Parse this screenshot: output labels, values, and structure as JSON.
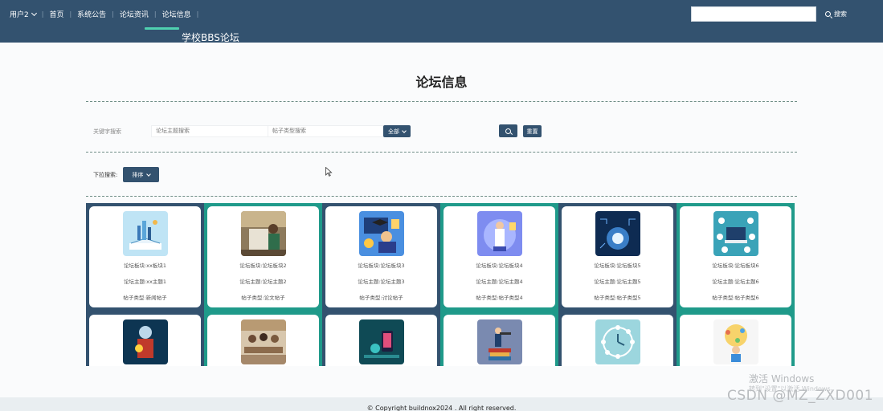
{
  "header": {
    "nav": [
      {
        "label": "用户2",
        "dropdown": true
      },
      {
        "label": "首页"
      },
      {
        "label": "系统公告"
      },
      {
        "label": "论坛资讯"
      },
      {
        "label": "论坛信息",
        "active": true
      }
    ],
    "site_title": "学校BBS论坛",
    "search_placeholder": "",
    "search_label": "搜索"
  },
  "page": {
    "title": "论坛信息"
  },
  "filters": {
    "keyword_label": "关键字搜索",
    "topic_placeholder": "论坛主题搜索",
    "type_placeholder": "帖子类型搜索",
    "all_label": "全部",
    "reset_label": "重置",
    "dropdown_label": "下拉搜索:",
    "sort_label": "排序"
  },
  "posts": [
    {
      "board": "论坛板块:xx板块1",
      "topic": "论坛主题:xx主题1",
      "type": "帖子类型:新闻帖子",
      "image": "book-city-illustration"
    },
    {
      "board": "论坛板块:论坛板块2",
      "topic": "论坛主题:论坛主题2",
      "type": "帖子类型:论文帖子",
      "image": "person-desk-photo"
    },
    {
      "board": "论坛板块:论坛板块3",
      "topic": "论坛主题:论坛主题3",
      "type": "帖子类型:讨论帖子",
      "image": "graduation-illustration"
    },
    {
      "board": "论坛板块:论坛板块4",
      "topic": "论坛主题:论坛主题4",
      "type": "帖子类型:帖子类型4",
      "image": "student-illustration"
    },
    {
      "board": "论坛板块:论坛板块5",
      "topic": "论坛主题:论坛主题5",
      "type": "帖子类型:帖子类型5",
      "image": "tech-glow-image"
    },
    {
      "board": "论坛板块:论坛板块6",
      "topic": "论坛主题:论坛主题6",
      "type": "帖子类型:帖子类型6",
      "image": "online-learning-icons"
    },
    {
      "board": "",
      "topic": "",
      "type": "",
      "image": "robot-hand-image"
    },
    {
      "board": "",
      "topic": "",
      "type": "",
      "image": "classroom-photo"
    },
    {
      "board": "",
      "topic": "",
      "type": "",
      "image": "mobile-app-image"
    },
    {
      "board": "",
      "topic": "",
      "type": "",
      "image": "telescope-books-illustration"
    },
    {
      "board": "",
      "topic": "",
      "type": "",
      "image": "clock-circle-image"
    },
    {
      "board": "",
      "topic": "",
      "type": "",
      "image": "kid-ideas-illustration"
    }
  ],
  "footer": {
    "copyright": "© Copyright buildnox2024 . All right reserved."
  },
  "overlays": {
    "activate_title": "激活 Windows",
    "activate_sub": "转到\"设置\"以激活 Windows。",
    "csdn": "CSDN @MZ_ZXD001"
  },
  "colors": {
    "header": "#33526f",
    "teal": "#1f9a8a",
    "navy": "#33526f",
    "accent": "#4fd1b0"
  }
}
